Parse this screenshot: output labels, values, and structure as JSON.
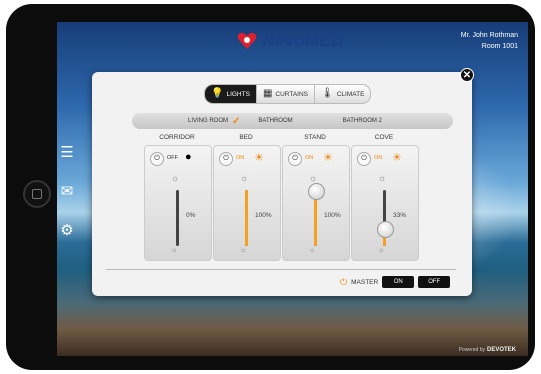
{
  "brand": {
    "name": "NevoMED",
    "heart_color": "#e0202e",
    "text_color": "#1a3f86"
  },
  "patient": {
    "name": "Mr. John Rothman",
    "room": "Room 1001"
  },
  "sidebar": {
    "items": [
      {
        "icon": "menu-icon"
      },
      {
        "icon": "mail-icon"
      },
      {
        "icon": "settings-icon"
      }
    ]
  },
  "tabs": [
    {
      "label": "LIGHTS",
      "icon": "bulb-icon",
      "active": true
    },
    {
      "label": "CURTAINS",
      "icon": "curtain-icon",
      "active": false
    },
    {
      "label": "CLIMATE",
      "icon": "thermometer-icon",
      "active": false
    }
  ],
  "rooms": [
    {
      "label": "LIVING ROOM",
      "selected": true
    },
    {
      "label": "BATHROOM",
      "selected": false
    },
    {
      "label": "BATHROOM 2",
      "selected": false
    }
  ],
  "lights": [
    {
      "label": "CORRIDOR",
      "state": "OFF",
      "value": "0%",
      "level": 0
    },
    {
      "label": "BED",
      "state": "ON",
      "value": "100%",
      "level": 1
    },
    {
      "label": "STAND",
      "state": "ON",
      "value": "100%",
      "level": 1
    },
    {
      "label": "COVE",
      "state": "ON",
      "value": "33%",
      "level": 0.33
    }
  ],
  "master": {
    "label": "MASTER",
    "on_label": "ON",
    "off_label": "OFF"
  },
  "footer": {
    "powered_by": "Powered by",
    "vendor": "DEVOTEK"
  },
  "colors": {
    "accent": "#f08a10",
    "fill": "#f5a020"
  }
}
